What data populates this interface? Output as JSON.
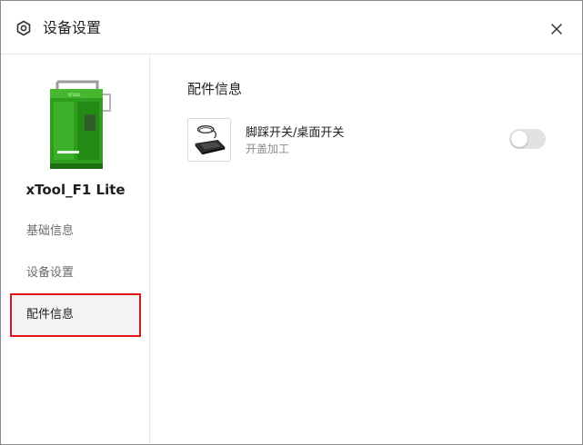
{
  "window": {
    "title": "设备设置",
    "title_icon": "settings-hex-icon",
    "close_icon": "close-icon"
  },
  "sidebar": {
    "device_name": "xTool_F1 Lite",
    "device_label": "XTOOL",
    "items": [
      {
        "label": "基础信息",
        "active": false
      },
      {
        "label": "设备设置",
        "active": false
      },
      {
        "label": "配件信息",
        "active": true
      }
    ]
  },
  "content": {
    "section_title": "配件信息",
    "accessories": [
      {
        "name": "脚踩开关/桌面开关",
        "description": "开盖加工",
        "icon": "foot-pedal-switch-icon",
        "enabled": false
      }
    ]
  },
  "colors": {
    "highlight": "#e0141b",
    "device_green": "#2f9e1e",
    "toggle_off": "#e2e2e2",
    "active_nav_bg": "#f3f3f3"
  }
}
